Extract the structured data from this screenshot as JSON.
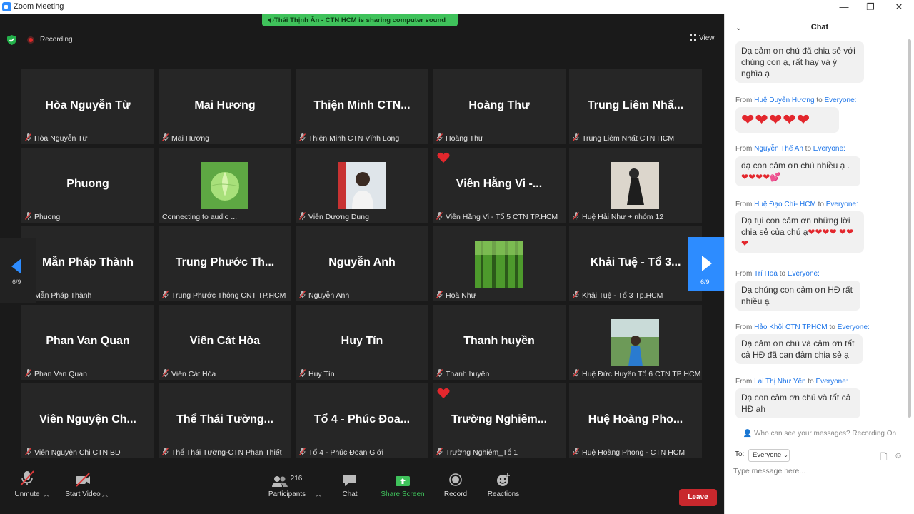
{
  "window": {
    "title": "Zoom Meeting",
    "controls": [
      "—",
      "❐",
      "✕"
    ]
  },
  "banner": {
    "text": "Thái Thịnh Ân - CTN HCM is sharing computer sound"
  },
  "top": {
    "recording_label": "Recording",
    "view_label": "View"
  },
  "tiles": [
    {
      "big": "Hòa Nguyễn Từ",
      "small": "Hòa Nguyễn Từ"
    },
    {
      "big": "Mai Hương",
      "small": "Mai Hương"
    },
    {
      "big": "Thiện Minh CTN...",
      "small": "Thiện Minh CTN Vĩnh Long"
    },
    {
      "big": "Hoàng Thư",
      "small": "Hoàng Thư"
    },
    {
      "big": "Trung Liêm Nhấ...",
      "small": "Trung Liêm Nhất CTN HCM"
    },
    {
      "big": "Phuong",
      "small": "Phuong"
    },
    {
      "big": "",
      "small": "Connecting to audio ...",
      "photo": "lotus"
    },
    {
      "big": "",
      "small": "Viên Dương Dung",
      "photo": "girl"
    },
    {
      "big": "Viên Hằng Vi -...",
      "small": "Viên Hằng Vi - Tổ 5 CTN TP.HCM",
      "heart": true
    },
    {
      "big": "",
      "small": "Huệ Hải Như + nhóm 12",
      "photo": "sitting"
    },
    {
      "big": "Mẫn Pháp Thành",
      "small": "Mẫn Pháp Thành"
    },
    {
      "big": "Trung Phước Th...",
      "small": "Trung Phước Thông CNT TP.HCM"
    },
    {
      "big": "Nguyễn Anh",
      "small": "Nguyễn Anh"
    },
    {
      "big": "",
      "small": "Hoà Như",
      "photo": "forest"
    },
    {
      "big": "Khải Tuệ - Tổ 3...",
      "small": "Khải Tuệ - Tổ 3 Tp.HCM"
    },
    {
      "big": "Phan Van Quan",
      "small": "Phan Van Quan"
    },
    {
      "big": "Viên Cát Hòa",
      "small": "Viên Cát Hòa"
    },
    {
      "big": "Huy Tín",
      "small": "Huy Tín"
    },
    {
      "big": "Thanh huyền",
      "small": "Thanh huyền"
    },
    {
      "big": "",
      "small": "Huệ Đức Huyền Tổ 6 CTN TP HCM",
      "photo": "outdoor"
    },
    {
      "big": "Viên Nguyện Ch...",
      "small": "Viên Nguyện Chi CTN BD"
    },
    {
      "big": "Thể Thái Tường...",
      "small": "Thể Thái Tường-CTN Phan Thiết"
    },
    {
      "big": "Tổ 4 - Phúc Đoa...",
      "small": "Tổ 4 - Phúc Đoan Giới"
    },
    {
      "big": "Trường Nghiêm...",
      "small": "Trường Nghiêm_Tổ 1",
      "heart": true
    },
    {
      "big": "Huệ Hoàng Pho...",
      "small": "Huệ Hoàng Phong - CTN HCM"
    }
  ],
  "pager": {
    "left": "6/9",
    "right": "6/9"
  },
  "toolbar": {
    "unmute": "Unmute",
    "start_video": "Start Video",
    "participants": "Participants",
    "participants_count": "216",
    "chat": "Chat",
    "share": "Share Screen",
    "record": "Record",
    "reactions": "Reactions",
    "leave": "Leave"
  },
  "chat": {
    "title": "Chat",
    "messages": [
      {
        "from": "",
        "to": "",
        "text": "Dạ cảm ơn chú đã chia sẻ với chúng con ạ, rất hay và ý nghĩa ạ"
      },
      {
        "from": "Huệ Duyên Hương",
        "to": "Everyone:",
        "text": "❤❤❤❤❤"
      },
      {
        "from": "Nguyễn Thế An",
        "to": "Everyone:",
        "text": "dạ con cảm ơn chú nhiều ạ . ❤❤❤❤💕"
      },
      {
        "from": "Huệ Đạo Chí-  HCM",
        "to": "Everyone:",
        "text": "Dạ tụi con cảm ơn những lời chia sẻ của chú ạ❤❤❤❤ ❤❤❤"
      },
      {
        "from": "Trí Hoà",
        "to": "Everyone:",
        "text": "Dạ chúng con cảm ơn HĐ rất nhiều ạ"
      },
      {
        "from": "Hảo Khôi CTN TPHCM",
        "to": "Everyone:",
        "text": "Dạ cảm ơn chú và cảm ơn tất cả HĐ đã can đảm chia sẻ ạ"
      },
      {
        "from": "Lại Thị Như Yến",
        "to": "Everyone:",
        "text": "Dạ con cảm ơn chú và tất cả HĐ ah"
      }
    ],
    "from_word": "From",
    "to_word": "to",
    "who_can_see": "Who can see your messages? Recording On",
    "to_label": "To:",
    "to_value": "Everyone",
    "input_placeholder": "Type message here..."
  },
  "colors": {
    "accent": "#2d8cff",
    "leave": "#c8282d",
    "share": "#3fc25b",
    "link": "#1a73e8"
  }
}
